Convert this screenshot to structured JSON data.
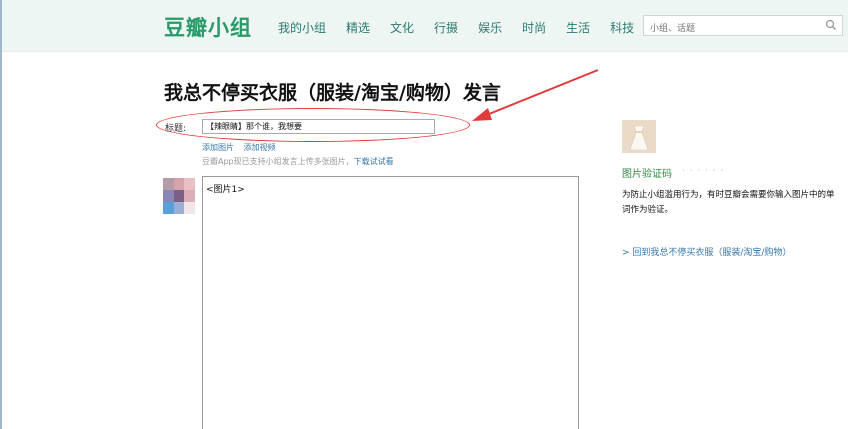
{
  "header": {
    "logo": "豆瓣小组",
    "nav": [
      "我的小组",
      "精选",
      "文化",
      "行摄",
      "娱乐",
      "时尚",
      "生活",
      "科技"
    ],
    "search_placeholder": "小组、话题"
  },
  "page_title": "我总不停买衣服（服装/淘宝/购物）发言",
  "form": {
    "title_label": "标题:",
    "title_value": "【辣眼睛】那个谁，我想要",
    "add_image": "添加图片",
    "add_video": "添加视频",
    "app_note": "豆瓣App现已支持小组发言上传多张图片，",
    "app_link": "下载试试看",
    "editor_content": "<图片1>"
  },
  "sidebar": {
    "captcha_title": "图片验证码",
    "captcha_dots": "· · · · · ·",
    "captcha_desc": "为防止小组滥用行为，有时豆瓣会需要你输入图片中的单词作为验证。",
    "back_link": "> 回到我总不停买衣服（服装/淘宝/购物）"
  },
  "colors": {
    "brand": "#2a9a6b",
    "nav": "#2e7a72",
    "link": "#3377aa",
    "annotation": "#e23a3a"
  }
}
